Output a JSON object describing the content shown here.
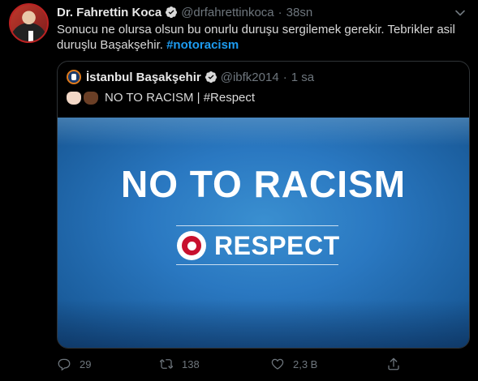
{
  "tweet": {
    "author_name": "Dr. Fahrettin Koca",
    "handle": "@drfahrettinkoca",
    "separator": "·",
    "time": "38sn",
    "text_main": "Sonucu ne olursa olsun bu onurlu duruşu sergilemek gerekir. Tebrikler asil duruşlu Başakşehir. ",
    "hashtag": "#notoracism"
  },
  "quote": {
    "author_name": "İstanbul Başakşehir",
    "handle": "@ibfk2014",
    "separator": "·",
    "time": "1 sa",
    "text": "NO TO RACISM | #Respect",
    "media": {
      "headline": "NO TO RACISM",
      "subline": "RESPECT"
    }
  },
  "actions": {
    "reply_count": "29",
    "retweet_count": "138",
    "like_count": "2,3 B"
  },
  "colors": {
    "background": "#000000",
    "link": "#1d9bf0",
    "muted": "#6e767d",
    "verified": "#d9d9d9",
    "media_blue": "#2a78c1"
  },
  "icons": [
    "verified-badge-icon",
    "chevron-down-icon",
    "reply-icon",
    "retweet-icon",
    "like-icon",
    "share-icon",
    "uefa-logo-icon",
    "basaksehir-logo-icon"
  ]
}
